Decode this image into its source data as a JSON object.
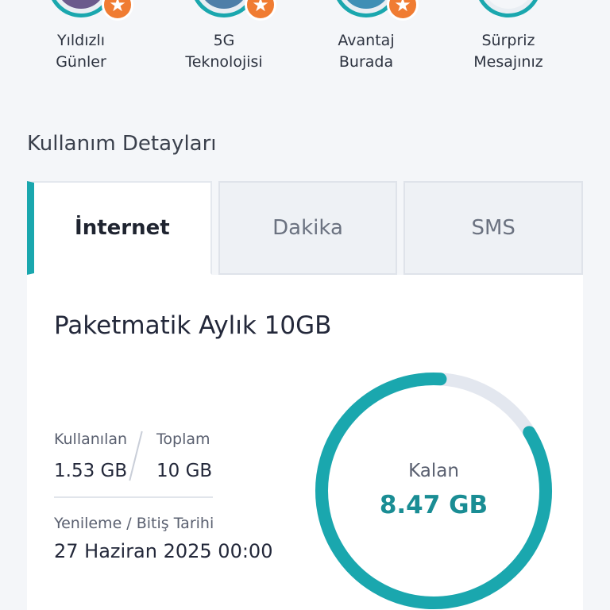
{
  "stories": [
    {
      "label_line1": "Yıldızlı",
      "label_line2": "Günler",
      "badge": true,
      "icon": "star-icon"
    },
    {
      "label_line1": "5G",
      "label_line2": "Teknolojisi",
      "badge": true,
      "icon": "star-icon"
    },
    {
      "label_line1": "Avantaj",
      "label_line2": "Burada",
      "badge": true,
      "icon": "star-icon"
    },
    {
      "label_line1": "Sürpriz",
      "label_line2": "Mesajınız",
      "badge": false,
      "icon": ""
    }
  ],
  "section": {
    "title": "Kullanım Detayları"
  },
  "tabs": [
    {
      "label": "İnternet",
      "active": true
    },
    {
      "label": "Dakika",
      "active": false
    },
    {
      "label": "SMS",
      "active": false
    }
  ],
  "card": {
    "package_name": "Paketmatik Aylık 10GB",
    "used_label": "Kullanılan",
    "used_value": "1.53 GB",
    "total_label": "Toplam",
    "total_value": "10 GB",
    "renew_label": "Yenileme / Bitiş Tarihi",
    "renew_value": "27 Haziran 2025 00:00",
    "remaining_label": "Kalan",
    "remaining_value": "8.47 GB",
    "remaining_fraction": 0.847
  },
  "colors": {
    "accent": "#1aa7ae",
    "badge": "#f07c32",
    "gauge_track": "#e3e7ef"
  }
}
